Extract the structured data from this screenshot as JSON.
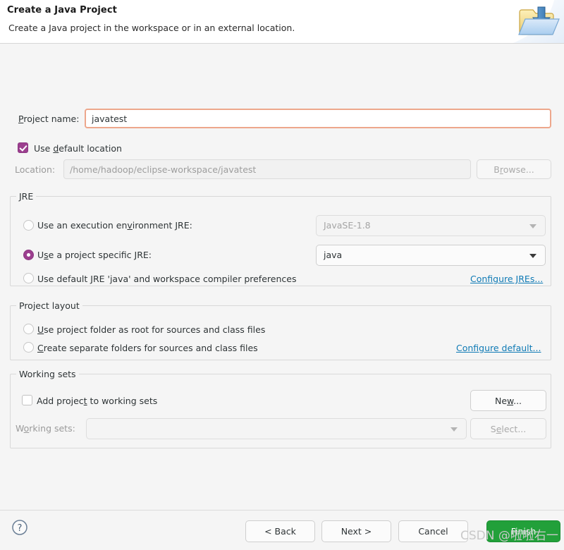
{
  "header": {
    "title": "Create a Java Project",
    "subtitle": "Create a Java project in the workspace or in an external location.",
    "icon": "new-java-project-folder-icon"
  },
  "project_name": {
    "label": "Project name:",
    "value": "javatest"
  },
  "location": {
    "use_default_label": "Use default location",
    "use_default_checked": true,
    "label": "Location:",
    "value": "/home/hadoop/eclipse-workspace/javatest",
    "browse_label": "Browse...",
    "browse_enabled": false
  },
  "jre": {
    "group_title": "JRE",
    "options": [
      {
        "label": "Use an execution environment JRE:",
        "selected": false,
        "combo_value": "JavaSE-1.8",
        "combo_enabled": false
      },
      {
        "label": "Use a project specific JRE:",
        "selected": true,
        "combo_value": "java",
        "combo_enabled": true
      },
      {
        "label": "Use default JRE 'java' and workspace compiler preferences",
        "selected": false
      }
    ],
    "configure_link": "Configure JREs..."
  },
  "project_layout": {
    "group_title": "Project layout",
    "options": [
      {
        "label": "Use project folder as root for sources and class files",
        "selected": false
      },
      {
        "label": "Create separate folders for sources and class files",
        "selected": true
      }
    ],
    "configure_link": "Configure default..."
  },
  "working_sets": {
    "group_title": "Working sets",
    "add_label": "Add project to working sets",
    "add_checked": false,
    "sets_label": "Working sets:",
    "sets_value": "",
    "new_label": "New...",
    "new_enabled": true,
    "select_label": "Select...",
    "select_enabled": false
  },
  "footer": {
    "help_icon": "help-question-icon",
    "back_label": "< Back",
    "next_label": "Next >",
    "cancel_label": "Cancel",
    "finish_label": "Finish"
  },
  "watermark": {
    "text": "CSDN @啦啦右一"
  },
  "colors": {
    "accent_purple": "#9c3f8f",
    "link_blue": "#0f7ab5",
    "finish_green": "#22a03a",
    "focus_orange": "#eda78c",
    "background": "#f5f5f5"
  }
}
